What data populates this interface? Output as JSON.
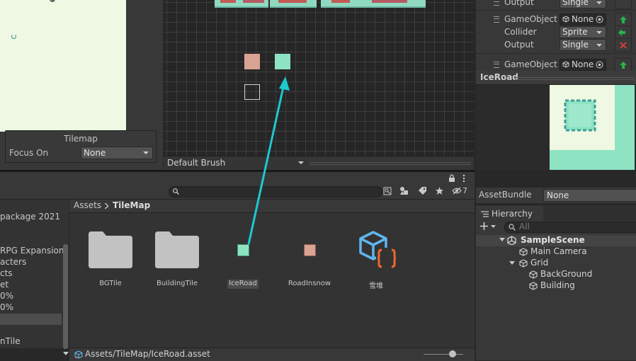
{
  "scene": {
    "overlay_title": "Tilemap",
    "focus_label": "Focus On",
    "focus_value": "None"
  },
  "palette": {
    "brush_value": "Default Brush"
  },
  "inspector": {
    "rows": [
      {
        "label": "Output",
        "value": "Single",
        "kind": "dropdown"
      },
      {
        "label": "GameObject",
        "value": "None",
        "kind": "object"
      },
      {
        "label": "Collider",
        "value": "Sprite",
        "kind": "dropdown"
      },
      {
        "label": "Output",
        "value": "Single",
        "kind": "dropdown"
      },
      {
        "label": "GameObject",
        "value": "None",
        "kind": "object"
      }
    ]
  },
  "preview": {
    "title": "IceRoad"
  },
  "project": {
    "hidden_count": "7",
    "breadcrumb": {
      "root": "Assets",
      "current": "TileMap"
    },
    "tree_items": [
      "package 2021",
      "RPG Expansion",
      "acters",
      "cts",
      "et",
      "0%",
      "0%",
      "",
      "",
      "nTile"
    ],
    "assets": [
      {
        "name": "BGTile",
        "kind": "folder"
      },
      {
        "name": "BuildingTile",
        "kind": "folder"
      },
      {
        "name": "IceRoad",
        "kind": "tile-ice"
      },
      {
        "name": "RoadInsnow",
        "kind": "tile-road"
      },
      {
        "name": "雪堆",
        "kind": "script-asset"
      }
    ],
    "status_path": "Assets/TileMap/IceRoad.asset"
  },
  "assetbundle": {
    "label": "AssetBundle",
    "value": "None"
  },
  "hierarchy": {
    "tab_label": "Hierarchy",
    "search_placeholder": "All",
    "items": [
      {
        "label": "SampleScene",
        "depth": 0,
        "icon": "unity-icon"
      },
      {
        "label": "Main Camera",
        "depth": 1,
        "icon": "cube-icon"
      },
      {
        "label": "Grid",
        "depth": 1,
        "icon": "cube-icon"
      },
      {
        "label": "BackGround",
        "depth": 2,
        "icon": "cube-icon"
      },
      {
        "label": "Building",
        "depth": 2,
        "icon": "cube-icon"
      }
    ]
  },
  "colors": {
    "ice_tile": "#8de3c2",
    "road_tile": "#d9a393",
    "selection_arrow": "#1ec8d1",
    "script_icon_blue": "#5fb6ef",
    "script_icon_orange": "#f0682d"
  }
}
